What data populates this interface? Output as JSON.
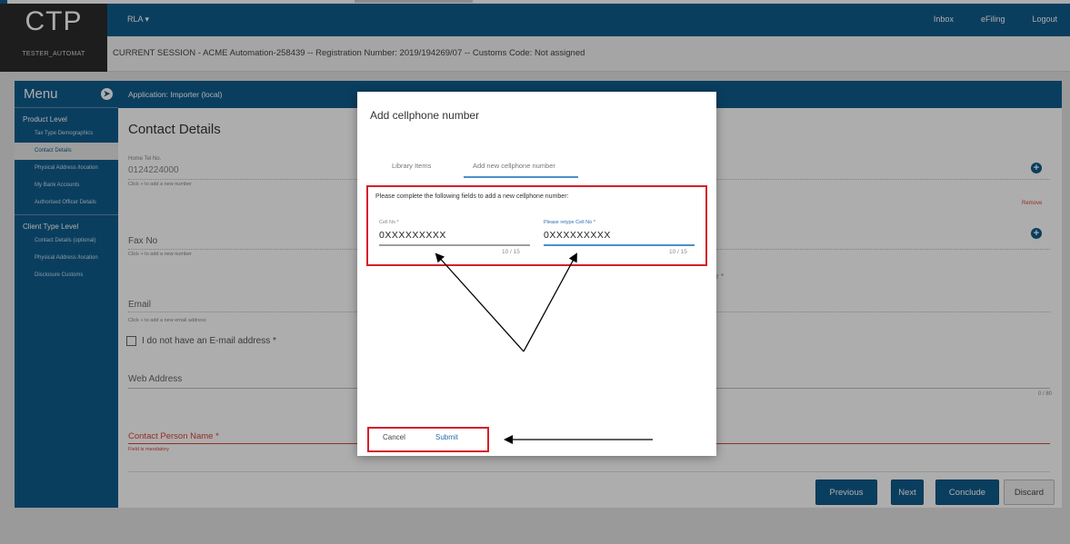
{
  "header": {
    "logo": "CTP",
    "menu_label": "RLA",
    "links": [
      "Inbox",
      "eFiling",
      "Logout"
    ]
  },
  "session": {
    "user": "TESTER_AUTOMAT",
    "text": "CURRENT SESSION - ACME Automation-258439 -- Registration Number: 2019/194269/07 -- Customs Code: Not assigned"
  },
  "sidebar": {
    "title": "Menu",
    "product_level_label": "Product Level",
    "product_items": [
      "Tax Type Demographics",
      "Contact Details",
      "Physical Address /location",
      "My Bank Accounts",
      "Authorised Officer Details"
    ],
    "client_level_label": "Client Type Level",
    "client_items": [
      "Contact Details (optional)",
      "Physical Address /location",
      "Disclosure Customs"
    ]
  },
  "main": {
    "app_bar": "Application: Importer (local)",
    "title": "Contact Details",
    "home_tel_label": "Home Tel No.",
    "home_tel_value": "0124224000",
    "home_tel_help": "Click + to add a new number",
    "remove_label": "Remove",
    "fax_label": "Fax No",
    "fax_help": "Click + to add a new number",
    "behind_modal_text": "r *",
    "email_label": "Email",
    "email_help": "Click + to add a new email address",
    "no_email_label": "I do not have an E-mail address *",
    "web_label": "Web Address",
    "web_counter": "0 / 80",
    "contact_person_label": "Contact Person Name *",
    "contact_person_help": "Field is mandatory",
    "buttons": {
      "previous": "Previous",
      "next": "Next",
      "conclude": "Conclude",
      "discard": "Discard"
    }
  },
  "modal": {
    "title": "Add cellphone number",
    "tabs": [
      "Library Items",
      "Add new cellphone number"
    ],
    "active_tab": 1,
    "instruction": "Please complete the following fields to add a new cellphone number:",
    "cell_label": "Cell No *",
    "cell_value": "0XXXXXXXXX",
    "cell_count": "10 / 15",
    "retype_label": "Please retype Cell No *",
    "retype_value": "0XXXXXXXXX",
    "retype_count": "10 / 15",
    "cancel_label": "Cancel",
    "submit_label": "Submit"
  },
  "colors": {
    "brand_blue": "#0f5c8c",
    "annotation_red": "#d4202a",
    "error_red": "#d9453c",
    "link_blue": "#2b6fb0"
  }
}
